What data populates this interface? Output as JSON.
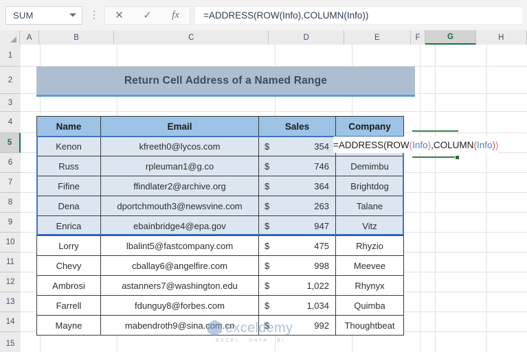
{
  "formula_bar": {
    "name_box_value": "SUM",
    "name_box_arrow_icon": "chevron-down-icon",
    "cancel_icon": "close-icon",
    "enter_icon": "check-icon",
    "function_icon": "fx-icon",
    "cancel_label": "✕",
    "enter_label": "✓",
    "fx_label": "fx",
    "formula": "=ADDRESS(ROW(Info),COLUMN(Info))"
  },
  "sheet": {
    "column_headers": [
      "A",
      "B",
      "C",
      "D",
      "E",
      "F",
      "G",
      "H"
    ],
    "selected_column": "G",
    "row_headers": [
      "1",
      "2",
      "3",
      "4",
      "5",
      "6",
      "7",
      "8",
      "9",
      "10",
      "11",
      "12",
      "13",
      "14",
      "15"
    ],
    "selected_row": "5"
  },
  "banner": {
    "title": "Return Cell Address of a Named Range"
  },
  "table": {
    "headers": [
      "Name",
      "Email",
      "Sales",
      "Company"
    ],
    "currency_symbol": "$",
    "rows": [
      {
        "name": "Kenon",
        "email": "kfreeth0@lycos.com",
        "sales": "354",
        "company": "",
        "shaded": true
      },
      {
        "name": "Russ",
        "email": "rpleuman1@g.co",
        "sales": "746",
        "company": "Demimbu",
        "shaded": true
      },
      {
        "name": "Fifine",
        "email": "ffindlater2@archive.org",
        "sales": "364",
        "company": "Brightdog",
        "shaded": true
      },
      {
        "name": "Dena",
        "email": "dportchmouth3@newsvine.com",
        "sales": "263",
        "company": "Talane",
        "shaded": true
      },
      {
        "name": "Enrica",
        "email": "ebainbridge4@epa.gov",
        "sales": "947",
        "company": "Vitz",
        "shaded": true
      },
      {
        "name": "Lorry",
        "email": "lbalint5@fastcompany.com",
        "sales": "475",
        "company": "Rhyzio",
        "shaded": false
      },
      {
        "name": "Chevy",
        "email": "cballay6@angelfire.com",
        "sales": "998",
        "company": "Meevee",
        "shaded": false
      },
      {
        "name": "Ambrosi",
        "email": "astanners7@washington.edu",
        "sales": "1,022",
        "company": "Rhynyx",
        "shaded": false
      },
      {
        "name": "Farrell",
        "email": "fdunguy8@forbes.com",
        "sales": "1,034",
        "company": "Quimba",
        "shaded": false
      },
      {
        "name": "Mayne",
        "email": "mabendroth9@sina.com.cn",
        "sales": "992",
        "company": "Thoughtbeat",
        "shaded": false
      }
    ]
  },
  "typed_formula": {
    "part1": "=ADDRESS(ROW",
    "open1": "(",
    "arg1": "Info",
    "close1": ")",
    "mid": ",COLUMN",
    "open2": "(",
    "arg2": "Info",
    "close2": ")",
    "tail": ")"
  },
  "watermark": {
    "text": "exceldemy",
    "tagline": "EXCEL · DATA · BI"
  },
  "colors": {
    "header_fill": "#9dc3e6",
    "banner_fill": "#aebdd0",
    "banner_accent": "#5b9bd5",
    "range_fill": "#dce6f1",
    "selection_border": "#3f72c4",
    "excel_green": "#0e7c3f",
    "formula_arg": "#4a7ebb"
  }
}
